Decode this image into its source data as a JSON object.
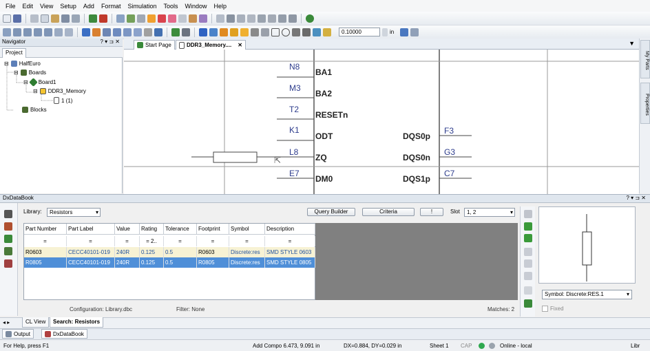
{
  "menu": [
    "File",
    "Edit",
    "View",
    "Setup",
    "Add",
    "Format",
    "Simulation",
    "Tools",
    "Window",
    "Help"
  ],
  "toolbar": {
    "grid_value": "0.10000",
    "units": "in"
  },
  "navigator": {
    "title": "Navigator",
    "tab": "Project",
    "tree": {
      "root": "HalfEuro",
      "boards": "Boards",
      "board1": "Board1",
      "ddr3": "DDR3_Memory",
      "page": "1 (1)",
      "blocks": "Blocks"
    }
  },
  "doc_tabs": [
    {
      "label": "Start Page"
    },
    {
      "label": "DDR3_Memory...."
    }
  ],
  "right_tabs": {
    "my_parts": "My Parts",
    "properties": "Properties"
  },
  "schematic": {
    "left_pins": [
      {
        "num": "N8",
        "name": "BA1"
      },
      {
        "num": "M3",
        "name": "BA2"
      },
      {
        "num": "T2",
        "name": "RESETn"
      },
      {
        "num": "K1",
        "name": "ODT"
      },
      {
        "num": "L8",
        "name": "ZQ"
      },
      {
        "num": "E7",
        "name": "DM0"
      }
    ],
    "right_pins": [
      {
        "num": "F3",
        "name": "DQS0p"
      },
      {
        "num": "G3",
        "name": "DQS0n"
      },
      {
        "num": "C7",
        "name": "DQS1p"
      }
    ]
  },
  "databook": {
    "title": "DxDataBook",
    "library_label": "Library:",
    "library_value": "Resistors",
    "query_builder": "Query Builder",
    "criteria": "Criteria",
    "bang": "!",
    "slot_label": "Slot",
    "slot_value": "1, 2",
    "columns": [
      "Part Number",
      "Part Label",
      "Value",
      "Rating",
      "Tolerance",
      "Footprint",
      "Symbol",
      "Description"
    ],
    "filter_row": [
      "=",
      "=",
      "=",
      "= 2..",
      "=",
      "=",
      "=",
      "="
    ],
    "rows": [
      [
        "R0603",
        "CECC40101-019",
        "240R",
        "0.125",
        "0.5",
        "R0603",
        "Discrete:res",
        "SMD STYLE 0603"
      ],
      [
        "R0805",
        "CECC40101-019",
        "240R",
        "0.125",
        "0.5",
        "R0805",
        "Discrete:res",
        "SMD STYLE 0805"
      ]
    ],
    "configuration": "Configuration: Library.dbc",
    "filter": "Filter: None",
    "matches": "Matches: 2",
    "symbol_value": "Symbol: Discrete:RES.1",
    "fixed_label": "Fixed",
    "tabs": [
      "CL View",
      "Search: Resistors"
    ]
  },
  "output_tabs": [
    "Output",
    "DxDataBook"
  ],
  "status": {
    "help": "For Help, press F1",
    "add_compo": "Add Compo 6.473, 9.091 in",
    "dx": "DX=0.884, DY=0.029 in",
    "sheet": "Sheet 1",
    "cap": "CAP",
    "online": "Online - local",
    "libr": "Libr"
  }
}
